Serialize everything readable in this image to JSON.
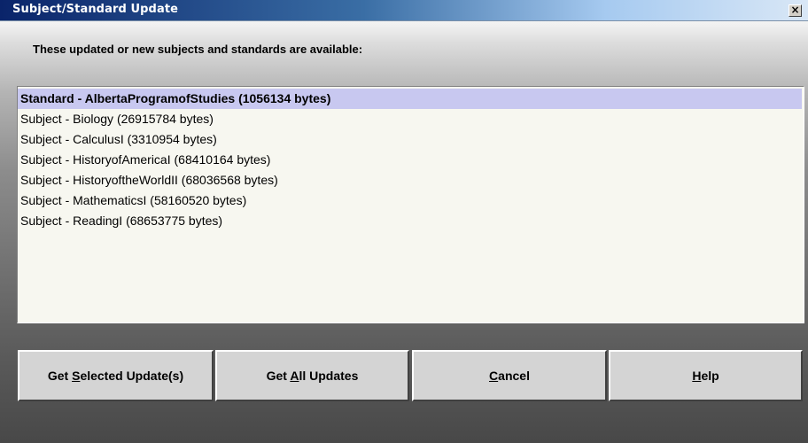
{
  "window": {
    "title": "Subject/Standard Update",
    "close_label": "×"
  },
  "header": {
    "label": "These updated or new subjects and standards are available:"
  },
  "list": {
    "items": [
      {
        "label": "Standard - AlbertaProgramofStudies (1056134 bytes)",
        "selected": true
      },
      {
        "label": "Subject - Biology (26915784 bytes)",
        "selected": false
      },
      {
        "label": "Subject - CalculusI (3310954 bytes)",
        "selected": false
      },
      {
        "label": "Subject - HistoryofAmericaI (68410164 bytes)",
        "selected": false
      },
      {
        "label": "Subject - HistoryoftheWorldII (68036568 bytes)",
        "selected": false
      },
      {
        "label": "Subject - MathematicsI (58160520 bytes)",
        "selected": false
      },
      {
        "label": "Subject - ReadingI (68653775 bytes)",
        "selected": false
      }
    ]
  },
  "buttons": {
    "get_selected": {
      "pre": "Get ",
      "mnemonic": "S",
      "post": "elected Update(s)"
    },
    "get_all": {
      "pre": "Get ",
      "mnemonic": "A",
      "post": "ll Updates"
    },
    "cancel": {
      "pre": "",
      "mnemonic": "C",
      "post": "ancel"
    },
    "help": {
      "pre": "",
      "mnemonic": "H",
      "post": "elp"
    }
  },
  "colors": {
    "selection": "#c8c8f0",
    "title_bar_dark": "#0a246a",
    "title_bar_light": "#d9e7f6",
    "button_face": "#d4d4d4"
  }
}
